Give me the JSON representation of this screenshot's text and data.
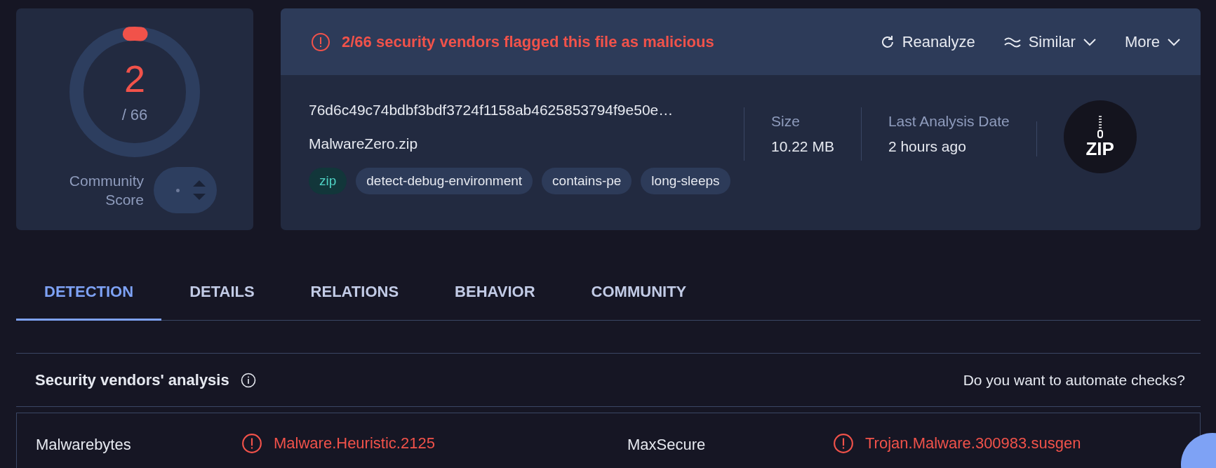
{
  "score": {
    "detections": "2",
    "total": "/ 66",
    "community_label": "Community Score"
  },
  "header": {
    "alert": "2/66 security vendors flagged this file as malicious",
    "actions": [
      {
        "label": "Reanalyze",
        "kind": "reload"
      },
      {
        "label": "Similar",
        "kind": "similar"
      },
      {
        "label": "More",
        "kind": "menu"
      }
    ]
  },
  "file": {
    "hash": "76d6c49c74bdbf3bdf3724f1158ab4625853794f9e50e…",
    "name": "MalwareZero.zip",
    "tags": [
      {
        "label": "zip",
        "kind": "filetype"
      },
      {
        "label": "detect-debug-environment",
        "kind": "tag"
      },
      {
        "label": "contains-pe",
        "kind": "tag"
      },
      {
        "label": "long-sleeps",
        "kind": "tag"
      }
    ],
    "stats": [
      {
        "label": "Size",
        "value": "10.22 MB"
      },
      {
        "label": "Last Analysis Date",
        "value": "2 hours ago"
      }
    ],
    "type_badge": "ZIP"
  },
  "tabs": [
    {
      "label": "DETECTION",
      "selected": true
    },
    {
      "label": "DETAILS",
      "selected": false
    },
    {
      "label": "RELATIONS",
      "selected": false
    },
    {
      "label": "BEHAVIOR",
      "selected": false
    },
    {
      "label": "COMMUNITY",
      "selected": false
    }
  ],
  "analysis": {
    "title": "Security vendors' analysis",
    "automate": "Do you want to automate checks?",
    "results": [
      {
        "vendor": "Malwarebytes",
        "result": "Malware.Heuristic.2125",
        "flagged": true
      },
      {
        "vendor": "MaxSecure",
        "result": "Trojan.Malware.300983.susgen",
        "flagged": true
      }
    ]
  }
}
